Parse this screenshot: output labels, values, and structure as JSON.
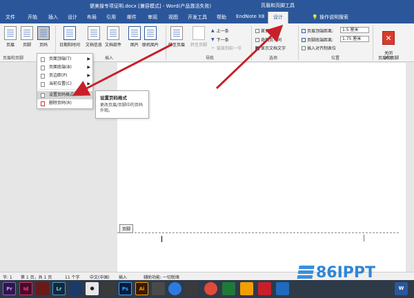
{
  "window": {
    "title": "健美操专项证明.docx [兼容模式] - Word(产品激活失败)",
    "context_tool": "页眉和页脚工具"
  },
  "tabs": [
    "文件",
    "开始",
    "插入",
    "设计",
    "布局",
    "引用",
    "邮件",
    "审阅",
    "视图",
    "开发工具",
    "帮助",
    "EndNote X8"
  ],
  "active_tab": "设计",
  "tell_me": "操作说明搜索",
  "ribbon": {
    "header": "页眉",
    "footer": "页脚",
    "page_number": "页码",
    "datetime": "日期和时间",
    "docinfo": "文档信息",
    "docparts": "文档部件",
    "picture": "图片",
    "online_picture": "联机图片",
    "goto_header": "转至页眉",
    "goto_footer": "转至页脚",
    "prev": "上一条",
    "next": "下一条",
    "link_prev": "链接到前一节",
    "opt_first": "首页不同",
    "opt_oddeven": "奇偶页不同",
    "opt_showtext": "显示文档文字",
    "header_pos_label": "页眉顶端距离:",
    "header_pos_value": "1.5 厘米",
    "footer_pos_label": "页脚底端距离:",
    "footer_pos_value": "1.75 厘米",
    "insert_align_tab": "插入对齐制表位",
    "close_label": "关闭\n页眉和页脚",
    "groups": {
      "header_footer": "页眉和页脚",
      "insert": "插入",
      "navigation": "导航",
      "options": "选项",
      "position": "位置",
      "close": "关闭"
    }
  },
  "menu": {
    "items": [
      "页面顶端(T)",
      "页面底端(B)",
      "页边距(P)",
      "当前位置(C)",
      "设置页码格式(F)...",
      "删除页码(R)"
    ]
  },
  "tooltip": {
    "title": "设置页码格式",
    "desc": "更改页眉/页脚中的页码外观。"
  },
  "document": {
    "footer_tag": "页脚"
  },
  "status": {
    "section": "节: 1",
    "page": "第 1 页，共 1 页",
    "words": "11 个字",
    "lang": "中文(中国)",
    "mode": "插入",
    "accessibility": "辅助功能: 一切就绪"
  },
  "taskbar": [
    "Pr",
    "Id",
    "",
    "Lr",
    "",
    "",
    "Ps",
    "Ai",
    "",
    "",
    "",
    "",
    "",
    "",
    "",
    "",
    "",
    "W"
  ],
  "watermark": "86IPPT",
  "colors": {
    "word_blue": "#2b579a",
    "arrow_red": "#c8202a"
  }
}
